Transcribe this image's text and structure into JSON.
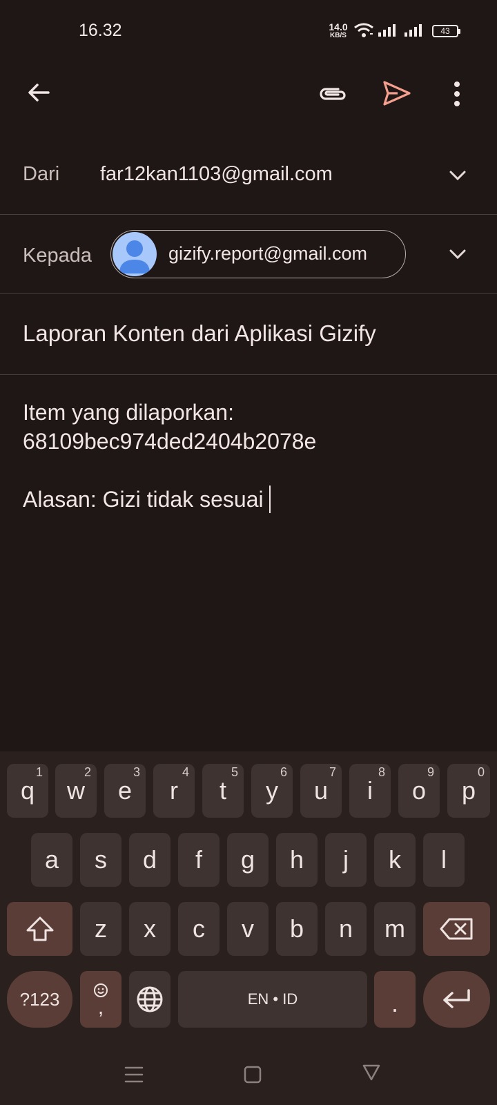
{
  "status_bar": {
    "time": "16.32",
    "net_speed": "14.0",
    "net_unit": "KB/S",
    "battery": "43"
  },
  "toolbar": {
    "back_icon": "arrow-left-icon",
    "attach_icon": "paperclip-icon",
    "send_icon": "send-icon",
    "more_icon": "more-vertical-icon",
    "send_color": "#f5a08e"
  },
  "compose": {
    "from_label": "Dari",
    "from_value": "far12kan1103@gmail.com",
    "to_label": "Kepada",
    "to_chip": "gizify.report@gmail.com",
    "subject": "Laporan Konten dari Aplikasi Gizify",
    "body_line1": "Item yang dilaporkan:",
    "body_line2": "68109bec974ded2404b2078e",
    "body_line3": "Alasan: Gizi tidak sesuai"
  },
  "keyboard": {
    "row1": [
      {
        "key": "q",
        "hint": "1"
      },
      {
        "key": "w",
        "hint": "2"
      },
      {
        "key": "e",
        "hint": "3"
      },
      {
        "key": "r",
        "hint": "4"
      },
      {
        "key": "t",
        "hint": "5"
      },
      {
        "key": "y",
        "hint": "6"
      },
      {
        "key": "u",
        "hint": "7"
      },
      {
        "key": "i",
        "hint": "8"
      },
      {
        "key": "o",
        "hint": "9"
      },
      {
        "key": "p",
        "hint": "0"
      }
    ],
    "row2": [
      "a",
      "s",
      "d",
      "f",
      "g",
      "h",
      "j",
      "k",
      "l"
    ],
    "row3": [
      "z",
      "x",
      "c",
      "v",
      "b",
      "n",
      "m"
    ],
    "symbols_label": "?123",
    "comma": ",",
    "space_label": "EN • ID",
    "period": ".",
    "shift_icon": "shift-icon",
    "backspace_icon": "backspace-icon",
    "emoji_icon": "emoji-icon",
    "globe_icon": "globe-icon",
    "enter_icon": "enter-icon"
  },
  "nav_bar": {
    "recents_icon": "menu-icon",
    "home_icon": "home-square-icon",
    "back_icon": "back-triangle-icon"
  }
}
